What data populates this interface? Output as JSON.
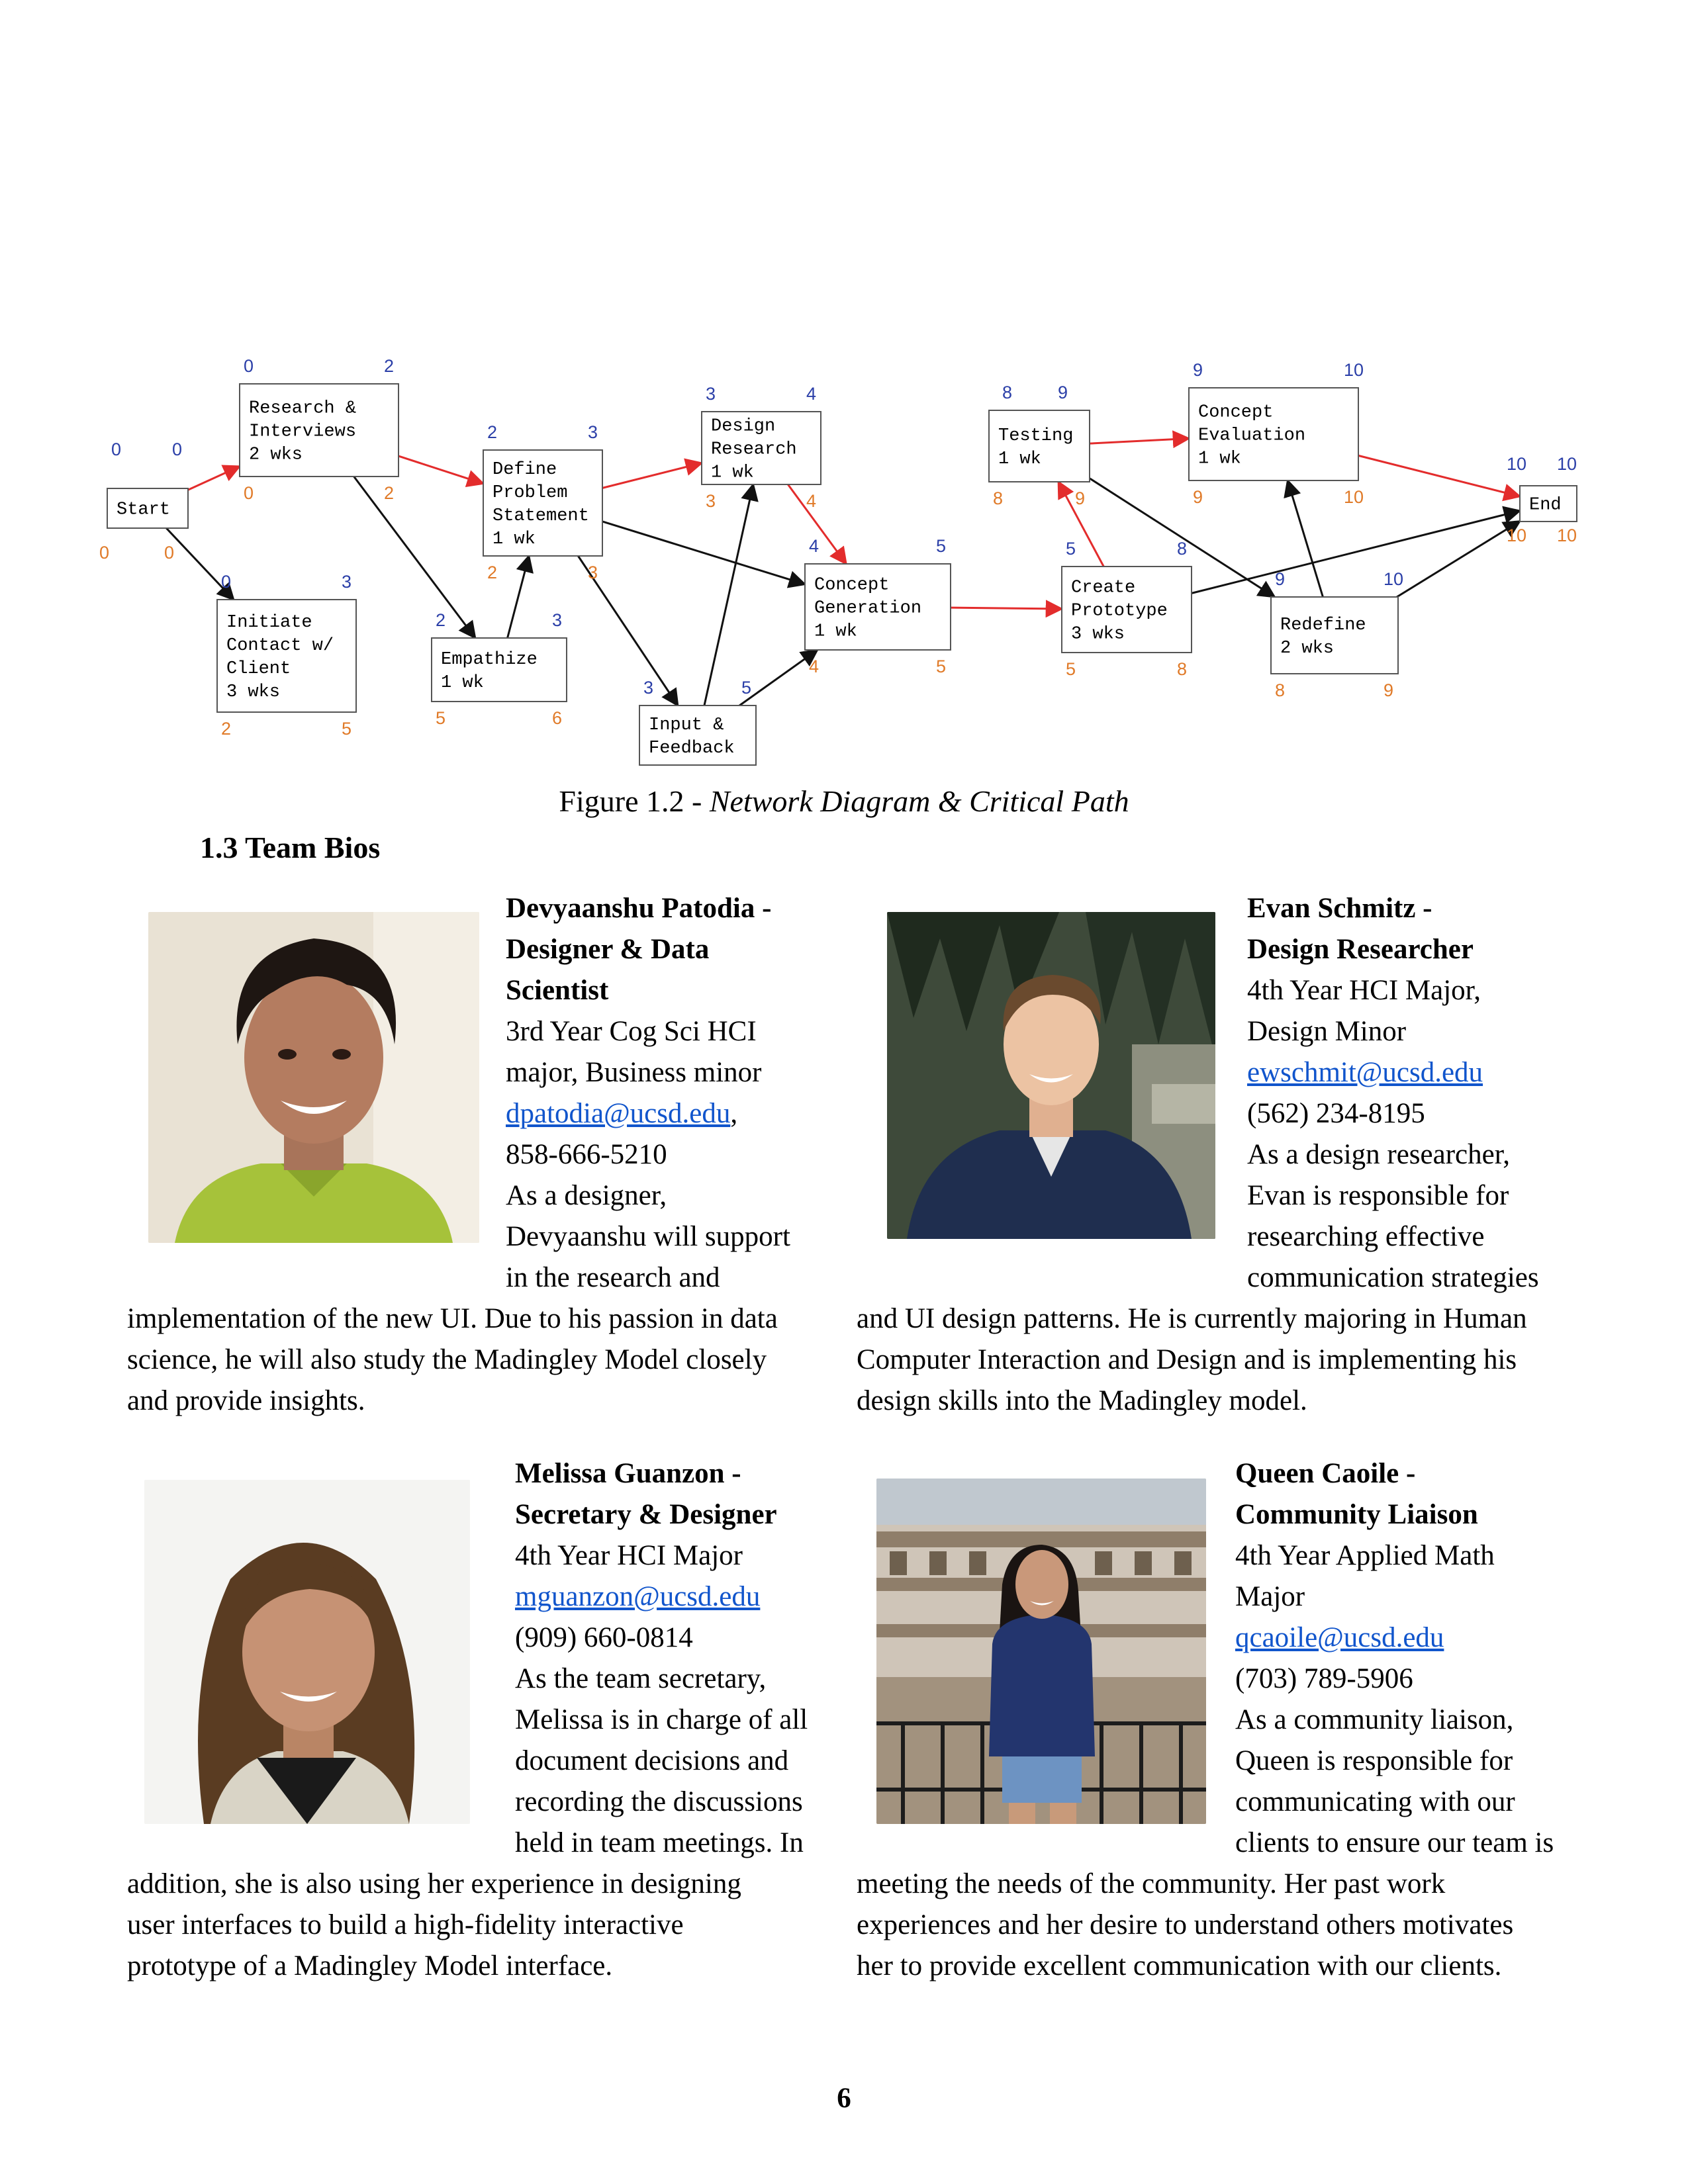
{
  "diagram": {
    "nodes": [
      {
        "id": "start",
        "lines": [
          "Start"
        ],
        "es": "0",
        "ef": "0",
        "ls": "0",
        "lf": "0"
      },
      {
        "id": "research",
        "lines": [
          "Research &",
          "Interviews",
          "2 wks"
        ],
        "es": "0",
        "ef": "2",
        "ls": "0",
        "lf": "2"
      },
      {
        "id": "initiate",
        "lines": [
          "Initiate",
          "Contact w/",
          "Client",
          " 3 wks"
        ],
        "es": "0",
        "ef": "3",
        "ls": "2",
        "lf": "5"
      },
      {
        "id": "define",
        "lines": [
          "Define",
          "Problem",
          "Statement",
          "1 wk"
        ],
        "es": "2",
        "ef": "3",
        "ls": "2",
        "lf": "3"
      },
      {
        "id": "empathize",
        "lines": [
          "Empathize",
          "1 wk"
        ],
        "es": "2",
        "ef": "3",
        "ls": "5",
        "lf": "6"
      },
      {
        "id": "design",
        "lines": [
          "Design",
          "Research",
          "1 wk"
        ],
        "es": "3",
        "ef": "4",
        "ls": "3",
        "lf": "4"
      },
      {
        "id": "input",
        "lines": [
          "Input &",
          "Feedback"
        ],
        "es": "3",
        "ef": "5",
        "ls": "",
        "lf": ""
      },
      {
        "id": "concept",
        "lines": [
          "Concept",
          "Generation",
          "1 wk"
        ],
        "es": "4",
        "ef": "5",
        "ls": "4",
        "lf": "5"
      },
      {
        "id": "testing",
        "lines": [
          "Testing",
          "1 wk"
        ],
        "es": "8",
        "ef": "9",
        "ls": "8",
        "lf": "9"
      },
      {
        "id": "prototype",
        "lines": [
          "Create",
          "Prototype",
          "3 wks"
        ],
        "es": "5",
        "ef": "8",
        "ls": "5",
        "lf": "8"
      },
      {
        "id": "evaluation",
        "lines": [
          "Concept",
          "Evaluation",
          "1 wk"
        ],
        "es": "9",
        "ef": "10",
        "ls": "9",
        "lf": "10"
      },
      {
        "id": "redefine",
        "lines": [
          "Redefine",
          "2 wks"
        ],
        "es": "9",
        "ef": "10",
        "ls": "8",
        "lf": "9"
      },
      {
        "id": "end",
        "lines": [
          "End"
        ],
        "es": "10",
        "ef": "10",
        "ls": "10",
        "lf": "10"
      }
    ],
    "edges": [
      {
        "from": "start",
        "to": "research",
        "critical": true
      },
      {
        "from": "start",
        "to": "initiate",
        "critical": false
      },
      {
        "from": "research",
        "to": "define",
        "critical": true
      },
      {
        "from": "research",
        "to": "empathize",
        "critical": false
      },
      {
        "from": "empathize",
        "to": "define",
        "critical": false
      },
      {
        "from": "define",
        "to": "design",
        "critical": true
      },
      {
        "from": "define",
        "to": "concept",
        "critical": false
      },
      {
        "from": "define",
        "to": "input",
        "critical": false
      },
      {
        "from": "input",
        "to": "design",
        "critical": false
      },
      {
        "from": "input",
        "to": "concept",
        "critical": false
      },
      {
        "from": "design",
        "to": "concept",
        "critical": true
      },
      {
        "from": "concept",
        "to": "prototype",
        "critical": true
      },
      {
        "from": "prototype",
        "to": "testing",
        "critical": true
      },
      {
        "from": "testing",
        "to": "evaluation",
        "critical": true
      },
      {
        "from": "testing",
        "to": "redefine",
        "critical": false
      },
      {
        "from": "redefine",
        "to": "evaluation",
        "critical": false
      },
      {
        "from": "prototype",
        "to": "end",
        "critical": false
      },
      {
        "from": "redefine",
        "to": "end",
        "critical": false
      },
      {
        "from": "evaluation",
        "to": "end",
        "critical": true
      }
    ],
    "colors": {
      "early": "#2b3fa8",
      "late": "#e07a28",
      "critical": "#e32c2c",
      "normal": "#111111"
    }
  },
  "caption": {
    "prefix": "Figure 1.2 - ",
    "title": "Network Diagram & Critical Path"
  },
  "section_title": "1.3 Team Bios",
  "bios": [
    {
      "photo": "portrait-devyaanshu",
      "lines": [
        {
          "text": "Devyaanshu Patodia -",
          "bold": true
        },
        {
          "text": "Designer & Data",
          "bold": true
        },
        {
          "text": "Scientist",
          "bold": true
        },
        {
          "text": "3rd Year Cog Sci HCI"
        },
        {
          "text": "major, Business minor"
        },
        {
          "text": "dpatodia@ucsd.edu",
          "link": true,
          "suffix": ","
        },
        {
          "text": "858-666-5210"
        },
        {
          "text": "As a designer,"
        },
        {
          "text": "Devyaanshu will support"
        },
        {
          "text": "in the research and"
        },
        {
          "text": "implementation of the new UI. Due to his passion in data"
        },
        {
          "text": "science, he will also study the Madingley Model closely"
        },
        {
          "text": "and provide insights."
        }
      ]
    },
    {
      "photo": "portrait-evan",
      "lines": [
        {
          "text": "Evan Schmitz -",
          "bold": true
        },
        {
          "text": "Design Researcher",
          "bold": true
        },
        {
          "text": "4th Year HCI Major,"
        },
        {
          "text": "Design Minor"
        },
        {
          "text": "ewschmit@ucsd.edu",
          "link": true
        },
        {
          "text": "(562) 234-8195"
        },
        {
          "text": "As a design researcher,"
        },
        {
          "text": "Evan is responsible for"
        },
        {
          "text": "researching effective"
        },
        {
          "text": "communication strategies"
        },
        {
          "text": "and UI design patterns. He is currently majoring in Human"
        },
        {
          "text": "Computer Interaction and Design and is implementing his"
        },
        {
          "text": "design skills into the Madingley model."
        }
      ]
    },
    {
      "photo": "portrait-melissa",
      "lines": [
        {
          "text": "Melissa Guanzon -",
          "bold": true
        },
        {
          "text": "Secretary & Designer",
          "bold": true
        },
        {
          "text": "4th Year HCI Major"
        },
        {
          "text": "mguanzon@ucsd.edu",
          "link": true
        },
        {
          "text": "(909) 660-0814"
        },
        {
          "text": "As the team secretary,"
        },
        {
          "text": "Melissa is in charge of all"
        },
        {
          "text": "document decisions and"
        },
        {
          "text": "recording the discussions"
        },
        {
          "text": "held in team meetings. In"
        },
        {
          "text": "addition, she is also using her experience in designing"
        },
        {
          "text": "user interfaces to build a high-fidelity interactive"
        },
        {
          "text": "prototype of a Madingley Model interface."
        }
      ]
    },
    {
      "photo": "portrait-queen",
      "lines": [
        {
          "text": "Queen Caoile -",
          "bold": true
        },
        {
          "text": "Community Liaison",
          "bold": true
        },
        {
          "text": "4th Year Applied Math"
        },
        {
          "text": "Major"
        },
        {
          "text": "qcaoile@ucsd.edu",
          "link": true
        },
        {
          "text": "(703) 789-5906"
        },
        {
          "text": "As a community liaison,"
        },
        {
          "text": "Queen is responsible for"
        },
        {
          "text": "communicating with our"
        },
        {
          "text": "clients to ensure our team is"
        },
        {
          "text": "meeting the needs of the community. Her past work"
        },
        {
          "text": "experiences and her desire to understand others motivates"
        },
        {
          "text": "her to provide excellent communication with our clients."
        }
      ]
    }
  ],
  "page_number": "6"
}
